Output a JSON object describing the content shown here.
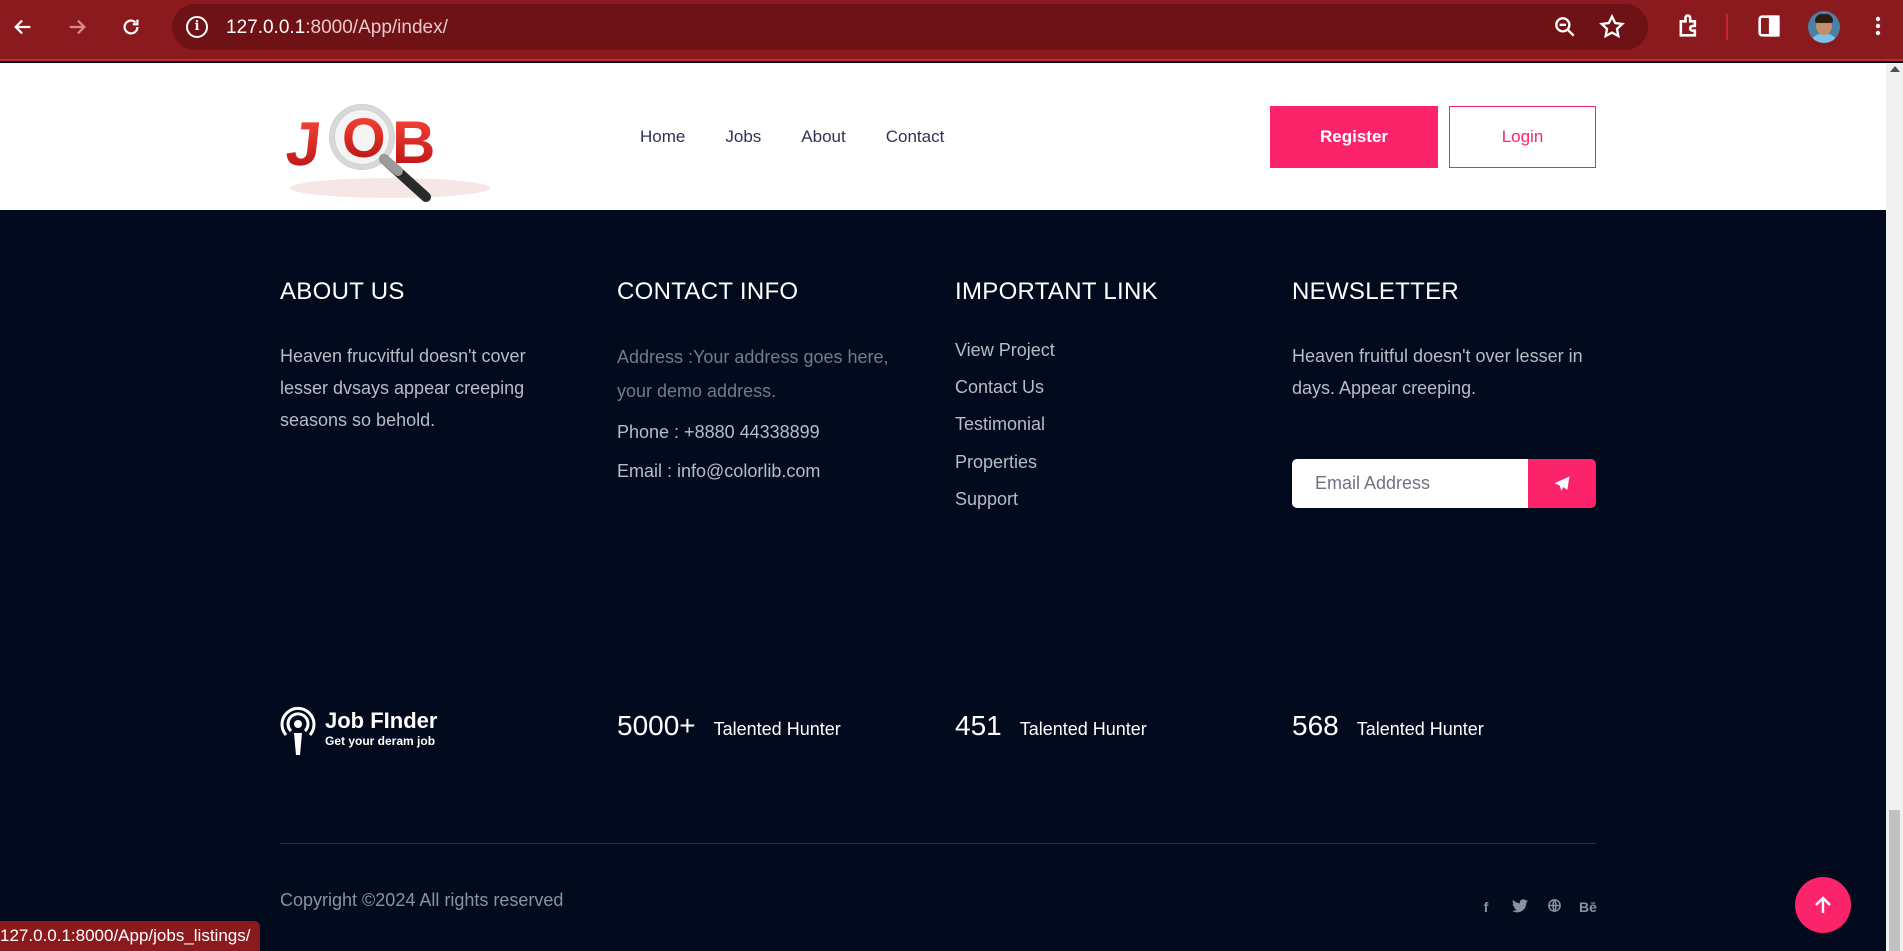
{
  "browser": {
    "url_host": "127.0.0.1",
    "url_path": ":8000/App/index/",
    "status_url": "127.0.0.1:8000/App/jobs_listings/"
  },
  "header": {
    "logo_alt": "JOB",
    "nav": [
      "Home",
      "Jobs",
      "About",
      "Contact"
    ],
    "register_label": "Register",
    "login_label": "Login"
  },
  "footer": {
    "about": {
      "title": "ABOUT US",
      "text": "Heaven frucvitful doesn't cover lesser dvsays appear creeping seasons so behold."
    },
    "contact": {
      "title": "CONTACT INFO",
      "address": "Address :Your address goes here, your demo address.",
      "phone": "Phone : +8880 44338899",
      "email": "Email : info@colorlib.com"
    },
    "links": {
      "title": "IMPORTANT LINK",
      "items": [
        "View Project",
        "Contact Us",
        "Testimonial",
        "Properties",
        "Support"
      ]
    },
    "newsletter": {
      "title": "NEWSLETTER",
      "text": "Heaven fruitful doesn't over lesser in days. Appear creeping.",
      "placeholder": "Email Address"
    },
    "brand": {
      "name": "Job FInder",
      "tagline": "Get your deram job"
    },
    "stats": [
      {
        "value": "5000+",
        "label": "Talented Hunter"
      },
      {
        "value": "451",
        "label": "Talented Hunter"
      },
      {
        "value": "568",
        "label": "Talented Hunter"
      }
    ],
    "copyright": "Copyright ©2024 All rights reserved",
    "socials": [
      "f",
      "t",
      "globe",
      "Bē"
    ]
  },
  "colors": {
    "accent": "#fb246a",
    "footer_bg": "#010b1d",
    "chrome": "#8b1a1e"
  }
}
